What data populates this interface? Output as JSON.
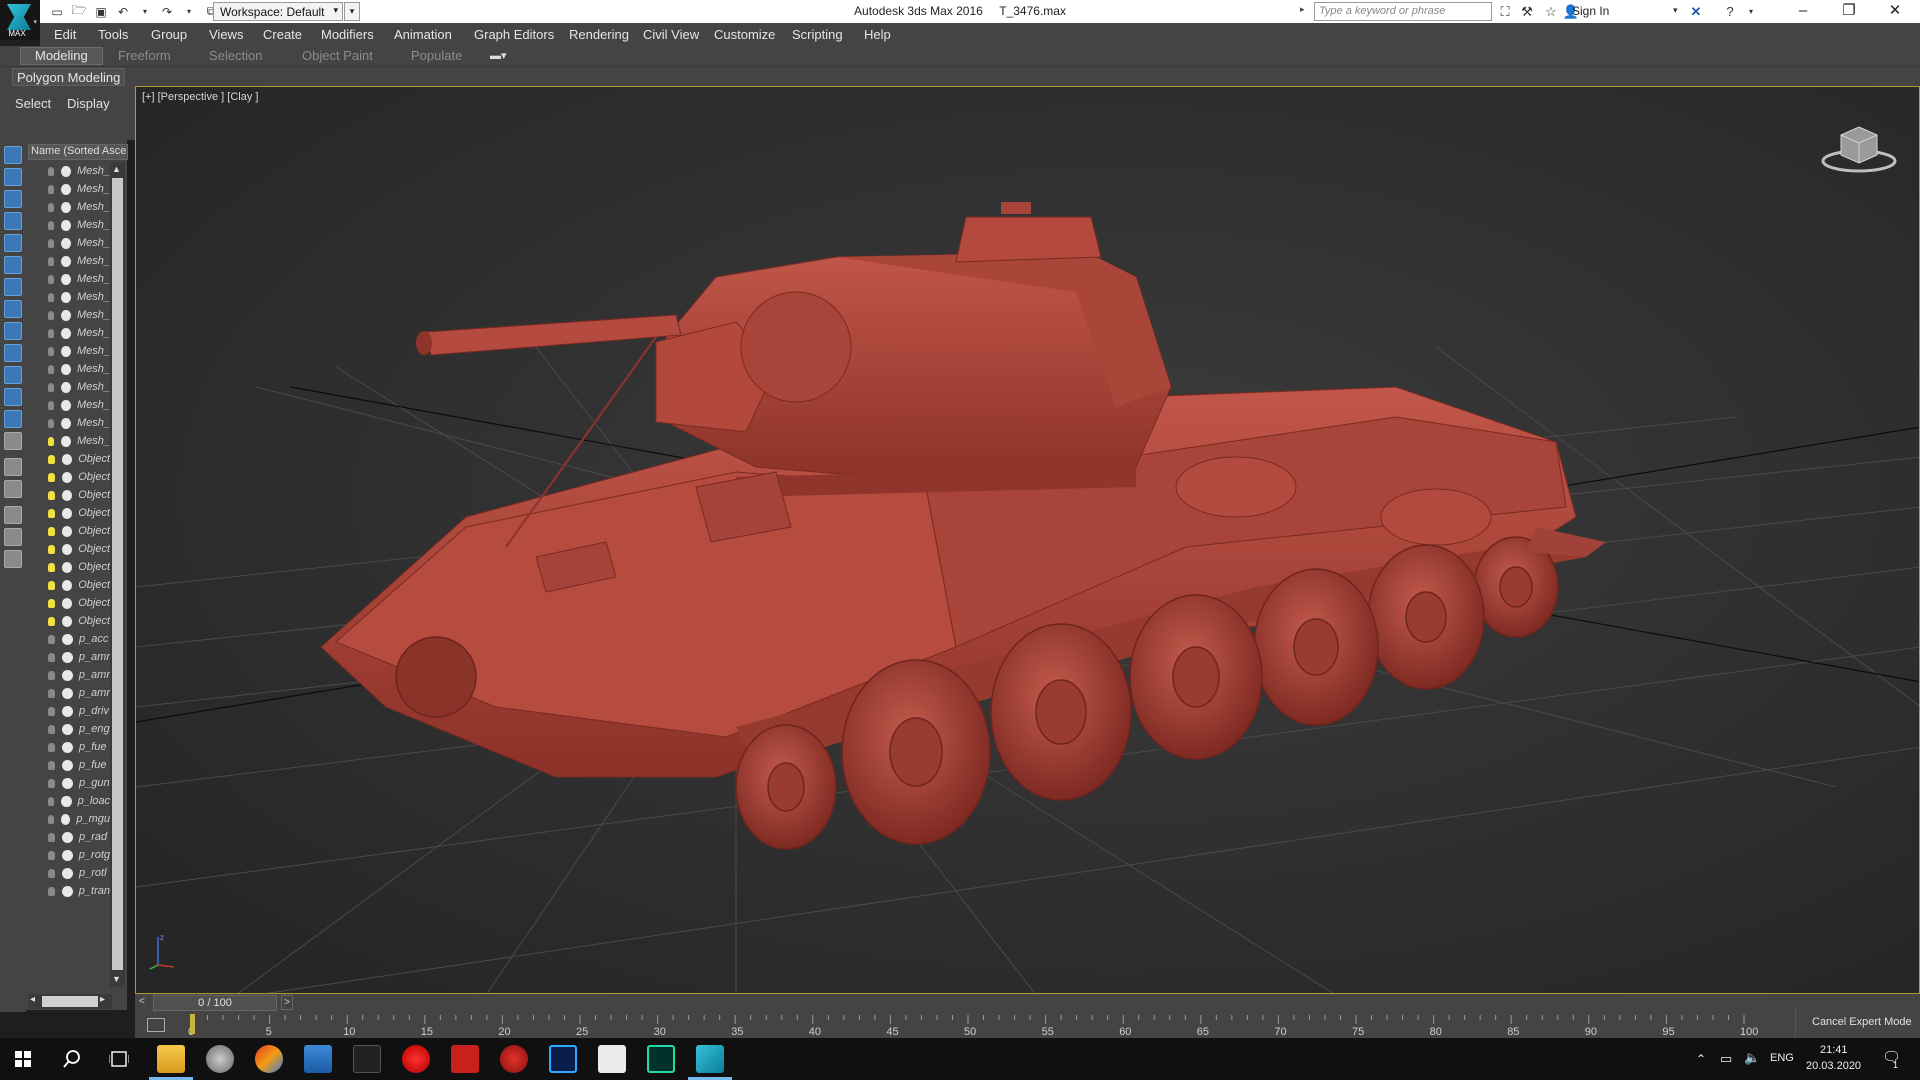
{
  "app": {
    "logo_text": "MAX",
    "title": "Autodesk 3ds Max 2016     T_3476.max",
    "workspace": "Workspace: Default",
    "search_placeholder": "Type a keyword or phrase",
    "sign_in": "Sign In"
  },
  "menu": [
    "Edit",
    "Tools",
    "Group",
    "Views",
    "Create",
    "Modifiers",
    "Animation",
    "Graph Editors",
    "Rendering",
    "Civil View",
    "Customize",
    "Scripting",
    "Help"
  ],
  "ribbon": {
    "tabs": [
      "Modeling",
      "Freeform",
      "Selection",
      "Object Paint",
      "Populate"
    ],
    "active_tab": "Modeling",
    "panel_label": "Polygon Modeling"
  },
  "scene_explorer": {
    "tabs": [
      "Select",
      "Display"
    ],
    "column_header": "Name (Sorted Ascending)",
    "rows": [
      {
        "name": "Mesh_",
        "light": false
      },
      {
        "name": "Mesh_",
        "light": false
      },
      {
        "name": "Mesh_",
        "light": false
      },
      {
        "name": "Mesh_",
        "light": false
      },
      {
        "name": "Mesh_",
        "light": false
      },
      {
        "name": "Mesh_",
        "light": false
      },
      {
        "name": "Mesh_",
        "light": false
      },
      {
        "name": "Mesh_",
        "light": false
      },
      {
        "name": "Mesh_",
        "light": false
      },
      {
        "name": "Mesh_",
        "light": false
      },
      {
        "name": "Mesh_",
        "light": false
      },
      {
        "name": "Mesh_",
        "light": false
      },
      {
        "name": "Mesh_",
        "light": false
      },
      {
        "name": "Mesh_",
        "light": false
      },
      {
        "name": "Mesh_",
        "light": false
      },
      {
        "name": "Mesh_",
        "light": true
      },
      {
        "name": "Object",
        "light": true
      },
      {
        "name": "Object",
        "light": true
      },
      {
        "name": "Object",
        "light": true
      },
      {
        "name": "Object",
        "light": true
      },
      {
        "name": "Object",
        "light": true
      },
      {
        "name": "Object",
        "light": true
      },
      {
        "name": "Object",
        "light": true
      },
      {
        "name": "Object",
        "light": true
      },
      {
        "name": "Object",
        "light": true
      },
      {
        "name": "Object",
        "light": true
      },
      {
        "name": "p_acc",
        "light": false
      },
      {
        "name": "p_amr",
        "light": false
      },
      {
        "name": "p_amr",
        "light": false
      },
      {
        "name": "p_amr",
        "light": false
      },
      {
        "name": "p_driv",
        "light": false
      },
      {
        "name": "p_eng",
        "light": false
      },
      {
        "name": "p_fue",
        "light": false
      },
      {
        "name": "p_fue",
        "light": false
      },
      {
        "name": "p_gun",
        "light": false
      },
      {
        "name": "p_loac",
        "light": false
      },
      {
        "name": "p_mgu",
        "light": false
      },
      {
        "name": "p_rad",
        "light": false
      },
      {
        "name": "p_rotg",
        "light": false
      },
      {
        "name": "p_rotl",
        "light": false
      },
      {
        "name": "p_tran",
        "light": false
      }
    ]
  },
  "viewport": {
    "label": "[+] [Perspective ] [Clay ]",
    "axis_label": "z",
    "model_color": "#b3493d",
    "border_color": "#b59a2c"
  },
  "timeline": {
    "frame_display": "0 / 100",
    "current_frame": 0,
    "total_frames": 100,
    "tick_labels": [
      "0",
      "5",
      "10",
      "15",
      "20",
      "25",
      "30",
      "35",
      "40",
      "45",
      "50",
      "55",
      "60",
      "65",
      "70",
      "75",
      "80",
      "85",
      "90",
      "95",
      "100"
    ],
    "cancel_expert": "Cancel Expert Mode"
  },
  "taskbar": {
    "apps": [
      "start-icon",
      "search-icon",
      "task-view-icon",
      "file-explorer-icon",
      "app-icon",
      "app-icon",
      "app-icon",
      "app-icon",
      "record-icon",
      "filezilla-icon",
      "app-icon",
      "photoshop-icon",
      "app-icon",
      "audition-icon",
      "3dsmax-icon"
    ],
    "language": "ENG",
    "time": "21:41",
    "date": "20.03.2020",
    "notification_count": "1"
  }
}
